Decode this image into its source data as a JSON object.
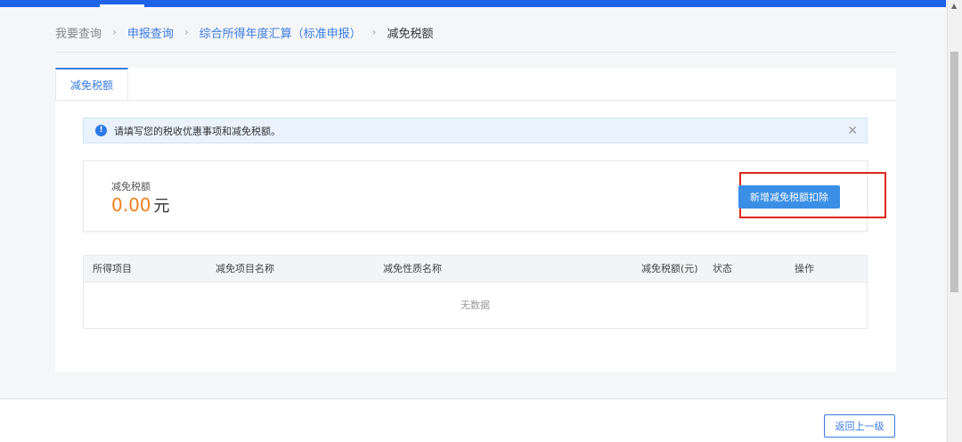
{
  "breadcrumb": {
    "items": [
      {
        "label": "我要查询"
      },
      {
        "label": "申报查询"
      },
      {
        "label": "综合所得年度汇算（标准申报）"
      },
      {
        "label": "减免税额"
      }
    ],
    "separator": "›"
  },
  "tabs": [
    {
      "label": "减免税额",
      "active": true
    }
  ],
  "alert": {
    "text": "请填写您的税收优惠事项和减免税额。",
    "icon": "info-icon",
    "close_icon": "close-icon"
  },
  "summary": {
    "label": "减免税额",
    "amount": "0.00",
    "unit": "元",
    "add_button": "新增减免税额扣除"
  },
  "table": {
    "columns": [
      "所得项目",
      "减免项目名称",
      "减免性质名称",
      "减免税额(元)",
      "状态",
      "操作"
    ],
    "empty_text": "无数据"
  },
  "footer": {
    "back_button": "返回上一级"
  },
  "colors": {
    "primary": "#3a7be0",
    "accent_orange": "#f0811f",
    "highlight_red": "#e0261c"
  }
}
